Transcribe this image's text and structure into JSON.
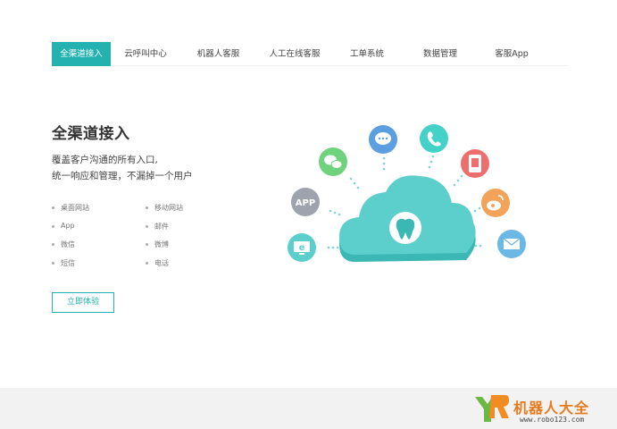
{
  "nav": {
    "tabs": [
      {
        "label": "全渠道接入",
        "active": true
      },
      {
        "label": "云呼叫中心",
        "active": false
      },
      {
        "label": "机器人客服",
        "active": false
      },
      {
        "label": "人工在线客服",
        "active": false
      },
      {
        "label": "工单系统",
        "active": false
      },
      {
        "label": "数据管理",
        "active": false
      },
      {
        "label": "客服App",
        "active": false
      }
    ]
  },
  "hero": {
    "title": "全渠道接入",
    "subtitle_line1": "覆盖客户沟通的所有入口,",
    "subtitle_line2": "统一响应和管理，不漏掉一个用户"
  },
  "features": {
    "items": [
      "桌面网站",
      "移动网站",
      "App",
      "邮件",
      "微信",
      "微博",
      "短信",
      "电话"
    ]
  },
  "cta": {
    "label": "立即体验"
  },
  "illustration": {
    "center_icon": "tooth-icon",
    "app_label": "APP",
    "channel_icons": [
      "ie-browser-icon",
      "app-icon",
      "wechat-icon",
      "chat-bubble-icon",
      "phone-icon",
      "mobile-site-icon",
      "weibo-icon",
      "mail-icon"
    ]
  },
  "watermark": {
    "text": "机器人大全",
    "url": "www.robo123.com"
  },
  "colors": {
    "accent": "#23b2b0",
    "cloud": "#5ccfcc",
    "watermark": "#e67b1e"
  }
}
